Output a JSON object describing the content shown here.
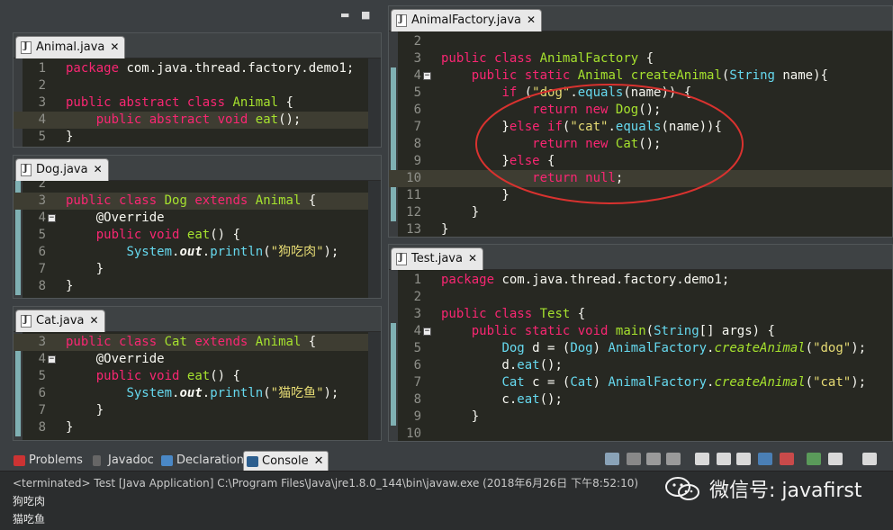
{
  "left_top_controls": {
    "minimize": "▬",
    "maximize": "■"
  },
  "panes": {
    "animal": {
      "tab": "Animal.java",
      "lines": [
        {
          "n": "1",
          "c": [
            [
              "k",
              "package"
            ],
            [
              "a",
              " com.java.thread.factory.demo1;"
            ]
          ]
        },
        {
          "n": "2",
          "c": []
        },
        {
          "n": "3",
          "c": [
            [
              "k",
              "public"
            ],
            [
              "a",
              " "
            ],
            [
              "k",
              "abstract"
            ],
            [
              "a",
              " "
            ],
            [
              "k",
              "class"
            ],
            [
              "a",
              " "
            ],
            [
              "f",
              "Animal"
            ],
            [
              "a",
              " {"
            ]
          ]
        },
        {
          "n": "4",
          "c": [
            [
              "a",
              "    "
            ],
            [
              "k",
              "public"
            ],
            [
              "a",
              " "
            ],
            [
              "k",
              "abstract"
            ],
            [
              "a",
              " "
            ],
            [
              "k",
              "void"
            ],
            [
              "a",
              " "
            ],
            [
              "f",
              "eat"
            ],
            [
              "a",
              "();"
            ]
          ]
        },
        {
          "n": "5",
          "c": [
            [
              "a",
              "}"
            ]
          ]
        }
      ]
    },
    "dog": {
      "tab": "Dog.java",
      "lines": [
        {
          "n": "2",
          "c": []
        },
        {
          "n": "3",
          "c": [
            [
              "k",
              "public"
            ],
            [
              "a",
              " "
            ],
            [
              "k",
              "class"
            ],
            [
              "a",
              " "
            ],
            [
              "f",
              "Dog"
            ],
            [
              "a",
              " "
            ],
            [
              "k",
              "extends"
            ],
            [
              "a",
              " "
            ],
            [
              "f",
              "Animal"
            ],
            [
              "a",
              " {"
            ]
          ]
        },
        {
          "n": "4",
          "c": [
            [
              "a",
              "    @Override"
            ]
          ]
        },
        {
          "n": "5",
          "c": [
            [
              "a",
              "    "
            ],
            [
              "k",
              "public"
            ],
            [
              "a",
              " "
            ],
            [
              "k",
              "void"
            ],
            [
              "a",
              " "
            ],
            [
              "f",
              "eat"
            ],
            [
              "a",
              "() {"
            ]
          ]
        },
        {
          "n": "6",
          "c": [
            [
              "a",
              "        "
            ],
            [
              "t",
              "System"
            ],
            [
              "a",
              "."
            ],
            [
              "o",
              "out"
            ],
            [
              "a",
              "."
            ],
            [
              "t",
              "println"
            ],
            [
              "a",
              "("
            ],
            [
              "s",
              "\"狗吃肉\""
            ],
            [
              "a",
              ");"
            ]
          ]
        },
        {
          "n": "7",
          "c": [
            [
              "a",
              "    }"
            ]
          ]
        },
        {
          "n": "8",
          "c": [
            [
              "a",
              "}"
            ]
          ]
        }
      ]
    },
    "cat": {
      "tab": "Cat.java",
      "lines": [
        {
          "n": "3",
          "c": [
            [
              "k",
              "public"
            ],
            [
              "a",
              " "
            ],
            [
              "k",
              "class"
            ],
            [
              "a",
              " "
            ],
            [
              "f",
              "Cat"
            ],
            [
              "a",
              " "
            ],
            [
              "k",
              "extends"
            ],
            [
              "a",
              " "
            ],
            [
              "f",
              "Animal"
            ],
            [
              "a",
              " {"
            ]
          ]
        },
        {
          "n": "4",
          "c": [
            [
              "a",
              "    @Override"
            ]
          ]
        },
        {
          "n": "5",
          "c": [
            [
              "a",
              "    "
            ],
            [
              "k",
              "public"
            ],
            [
              "a",
              " "
            ],
            [
              "k",
              "void"
            ],
            [
              "a",
              " "
            ],
            [
              "f",
              "eat"
            ],
            [
              "a",
              "() {"
            ]
          ]
        },
        {
          "n": "6",
          "c": [
            [
              "a",
              "        "
            ],
            [
              "t",
              "System"
            ],
            [
              "a",
              "."
            ],
            [
              "o",
              "out"
            ],
            [
              "a",
              "."
            ],
            [
              "t",
              "println"
            ],
            [
              "a",
              "("
            ],
            [
              "s",
              "\"猫吃鱼\""
            ],
            [
              "a",
              ");"
            ]
          ]
        },
        {
          "n": "7",
          "c": [
            [
              "a",
              "    }"
            ]
          ]
        },
        {
          "n": "8",
          "c": [
            [
              "a",
              "}"
            ]
          ]
        }
      ]
    },
    "factory": {
      "tab": "AnimalFactory.java",
      "lines": [
        {
          "n": "2",
          "c": []
        },
        {
          "n": "3",
          "c": [
            [
              "k",
              "public"
            ],
            [
              "a",
              " "
            ],
            [
              "k",
              "class"
            ],
            [
              "a",
              " "
            ],
            [
              "f",
              "AnimalFactory"
            ],
            [
              "a",
              " {"
            ]
          ]
        },
        {
          "n": "4",
          "c": [
            [
              "a",
              "    "
            ],
            [
              "k",
              "public"
            ],
            [
              "a",
              " "
            ],
            [
              "k",
              "static"
            ],
            [
              "a",
              " "
            ],
            [
              "f",
              "Animal"
            ],
            [
              "a",
              " "
            ],
            [
              "f",
              "createAnimal"
            ],
            [
              "a",
              "("
            ],
            [
              "t",
              "String"
            ],
            [
              "a",
              " name){"
            ]
          ]
        },
        {
          "n": "5",
          "c": [
            [
              "a",
              "        "
            ],
            [
              "k",
              "if"
            ],
            [
              "a",
              " ("
            ],
            [
              "s",
              "\"dog\""
            ],
            [
              "a",
              "."
            ],
            [
              "t",
              "equals"
            ],
            [
              "a",
              "(name)) {"
            ]
          ]
        },
        {
          "n": "6",
          "c": [
            [
              "a",
              "            "
            ],
            [
              "k",
              "return"
            ],
            [
              "a",
              " "
            ],
            [
              "k",
              "new"
            ],
            [
              "a",
              " "
            ],
            [
              "f",
              "Dog"
            ],
            [
              "a",
              "();"
            ]
          ]
        },
        {
          "n": "7",
          "c": [
            [
              "a",
              "        }"
            ],
            [
              "k",
              "else"
            ],
            [
              "a",
              " "
            ],
            [
              "k",
              "if"
            ],
            [
              "a",
              "("
            ],
            [
              "s",
              "\"cat\""
            ],
            [
              "a",
              "."
            ],
            [
              "t",
              "equals"
            ],
            [
              "a",
              "(name)){"
            ]
          ]
        },
        {
          "n": "8",
          "c": [
            [
              "a",
              "            "
            ],
            [
              "k",
              "return"
            ],
            [
              "a",
              " "
            ],
            [
              "k",
              "new"
            ],
            [
              "a",
              " "
            ],
            [
              "f",
              "Cat"
            ],
            [
              "a",
              "();"
            ]
          ]
        },
        {
          "n": "9",
          "c": [
            [
              "a",
              "        }"
            ],
            [
              "k",
              "else"
            ],
            [
              "a",
              " {"
            ]
          ]
        },
        {
          "n": "10",
          "c": [
            [
              "a",
              "            "
            ],
            [
              "k",
              "return"
            ],
            [
              "a",
              " "
            ],
            [
              "k",
              "null"
            ],
            [
              "a",
              ";"
            ]
          ]
        },
        {
          "n": "11",
          "c": [
            [
              "a",
              "        }"
            ]
          ]
        },
        {
          "n": "12",
          "c": [
            [
              "a",
              "    }"
            ]
          ]
        },
        {
          "n": "13",
          "c": [
            [
              "a",
              "}"
            ]
          ]
        }
      ]
    },
    "test": {
      "tab": "Test.java",
      "lines": [
        {
          "n": "1",
          "c": [
            [
              "k",
              "package"
            ],
            [
              "a",
              " com.java.thread.factory.demo1;"
            ]
          ]
        },
        {
          "n": "2",
          "c": []
        },
        {
          "n": "3",
          "c": [
            [
              "k",
              "public"
            ],
            [
              "a",
              " "
            ],
            [
              "k",
              "class"
            ],
            [
              "a",
              " "
            ],
            [
              "f",
              "Test"
            ],
            [
              "a",
              " {"
            ]
          ]
        },
        {
          "n": "4",
          "c": [
            [
              "a",
              "    "
            ],
            [
              "k",
              "public"
            ],
            [
              "a",
              " "
            ],
            [
              "k",
              "static"
            ],
            [
              "a",
              " "
            ],
            [
              "k",
              "void"
            ],
            [
              "a",
              " "
            ],
            [
              "f",
              "main"
            ],
            [
              "a",
              "("
            ],
            [
              "t",
              "String"
            ],
            [
              "a",
              "[] args) {"
            ]
          ]
        },
        {
          "n": "5",
          "c": [
            [
              "a",
              "        "
            ],
            [
              "t",
              "Dog"
            ],
            [
              "a",
              " d = ("
            ],
            [
              "t",
              "Dog"
            ],
            [
              "a",
              ") "
            ],
            [
              "t",
              "AnimalFactory"
            ],
            [
              "a",
              "."
            ],
            [
              "i",
              "createAnimal"
            ],
            [
              "a",
              "("
            ],
            [
              "s",
              "\"dog\""
            ],
            [
              "a",
              ");"
            ]
          ]
        },
        {
          "n": "6",
          "c": [
            [
              "a",
              "        d."
            ],
            [
              "t",
              "eat"
            ],
            [
              "a",
              "();"
            ]
          ]
        },
        {
          "n": "7",
          "c": [
            [
              "a",
              "        "
            ],
            [
              "t",
              "Cat"
            ],
            [
              "a",
              " c = ("
            ],
            [
              "t",
              "Cat"
            ],
            [
              "a",
              ") "
            ],
            [
              "t",
              "AnimalFactory"
            ],
            [
              "a",
              "."
            ],
            [
              "i",
              "createAnimal"
            ],
            [
              "a",
              "("
            ],
            [
              "s",
              "\"cat\""
            ],
            [
              "a",
              ");"
            ]
          ]
        },
        {
          "n": "8",
          "c": [
            [
              "a",
              "        c."
            ],
            [
              "t",
              "eat"
            ],
            [
              "a",
              "();"
            ]
          ]
        },
        {
          "n": "9",
          "c": [
            [
              "a",
              "    }"
            ]
          ]
        },
        {
          "n": "10",
          "c": []
        }
      ]
    }
  },
  "console": {
    "tabs": [
      "Problems",
      "Javadoc",
      "Declaration",
      "Console"
    ],
    "status": "<terminated> Test [Java Application] C:\\Program Files\\Java\\jre1.8.0_144\\bin\\javaw.exe (2018年6月26日 下午8:52:10)",
    "output": [
      "狗吃肉",
      "猫吃鱼"
    ]
  },
  "watermark": "微信号: javafirst",
  "colors": {
    "annotation_circle": "#d9322f",
    "ruler_mark": "#7fb0b3",
    "editor_bg": "#272822"
  }
}
